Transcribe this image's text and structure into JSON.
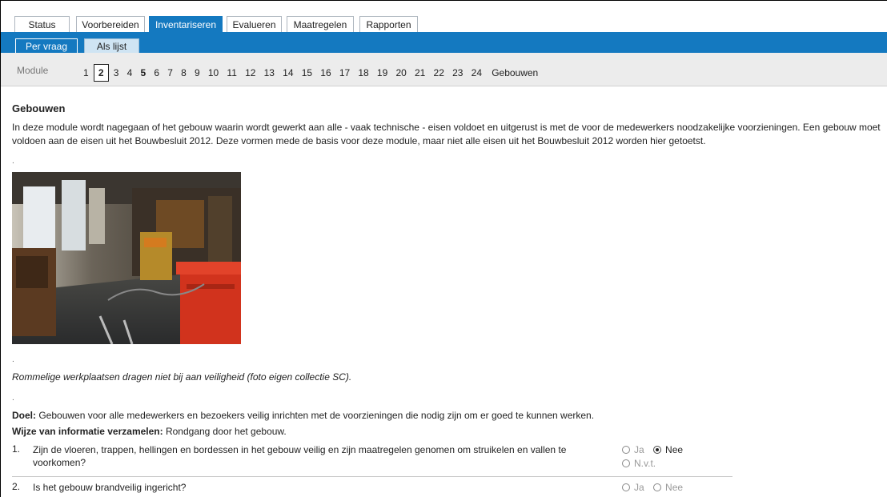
{
  "top_tabs": [
    {
      "label": "Status",
      "active": false
    },
    {
      "label": "Voorbereiden",
      "active": false
    },
    {
      "label": "Inventariseren",
      "active": true
    },
    {
      "label": "Evalueren",
      "active": false
    },
    {
      "label": "Maatregelen",
      "active": false
    },
    {
      "label": "Rapporten",
      "active": false
    }
  ],
  "sub_tabs": [
    {
      "label": "Per vraag",
      "active": false
    },
    {
      "label": "Als lijst",
      "active": true
    }
  ],
  "module_bar": {
    "label": "Module",
    "numbers": [
      "1",
      "2",
      "3",
      "4",
      "5",
      "6",
      "7",
      "8",
      "9",
      "10",
      "11",
      "12",
      "13",
      "14",
      "15",
      "16",
      "17",
      "18",
      "19",
      "20",
      "21",
      "22",
      "23",
      "24"
    ],
    "current": "2",
    "bold": [
      "5"
    ],
    "current_name": "Gebouwen"
  },
  "content": {
    "title": "Gebouwen",
    "intro": "In deze module wordt nagegaan of het gebouw waarin wordt gewerkt aan alle - vaak technische - eisen voldoet en uitgerust is met de voor de medewerkers noodzakelijke voorzieningen. Een gebouw moet voldoen aan de eisen uit het Bouwbesluit 2012. Deze vormen mede de basis voor deze module, maar niet alle eisen uit het Bouwbesluit 2012 worden hier getoetst.",
    "dot": ".",
    "caption": "Rommelige werkplaatsen dragen niet bij aan veiligheid (foto eigen collectie SC).",
    "goal_label": "Doel:",
    "goal_text": " Gebouwen voor alle medewerkers en bezoekers veilig inrichten met de voorzieningen die nodig zijn om er goed te kunnen werken.",
    "method_label": "Wijze van informatie verzamelen:",
    "method_text": " Rondgang door het gebouw."
  },
  "questions": [
    {
      "num": "1.",
      "text": "Zijn de vloeren, trappen, hellingen en bordessen in het gebouw veilig en zijn maatregelen genomen om struikelen en vallen te voorkomen?",
      "options": [
        "Ja",
        "Nee",
        "N.v.t."
      ],
      "selected": "Nee"
    },
    {
      "num": "2.",
      "text": "Is het gebouw brandveilig ingericht?",
      "options": [
        "Ja",
        "Nee"
      ],
      "selected": ""
    }
  ],
  "colors": {
    "accent": "#1479c0",
    "subtab_active": "#cfe4f3",
    "module_bar": "#ececec"
  }
}
